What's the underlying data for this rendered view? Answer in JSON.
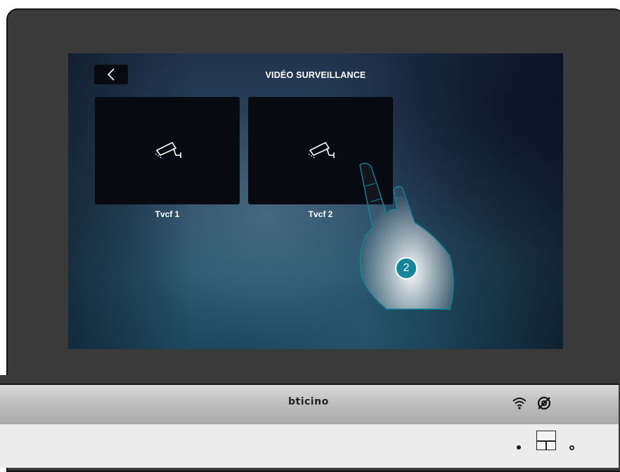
{
  "screen": {
    "title": "VIDÉO SURVEILLANCE",
    "tiles": [
      {
        "label": "Tvcf 1",
        "icon": "security-camera-icon"
      },
      {
        "label": "Tvcf 2",
        "icon": "security-camera-icon"
      }
    ]
  },
  "device": {
    "brand": "bticino",
    "status_icons": [
      "wifi-icon",
      "no-answering-machine-icon"
    ]
  },
  "overlay": {
    "step_number": "2",
    "step_color": "#16859a"
  }
}
